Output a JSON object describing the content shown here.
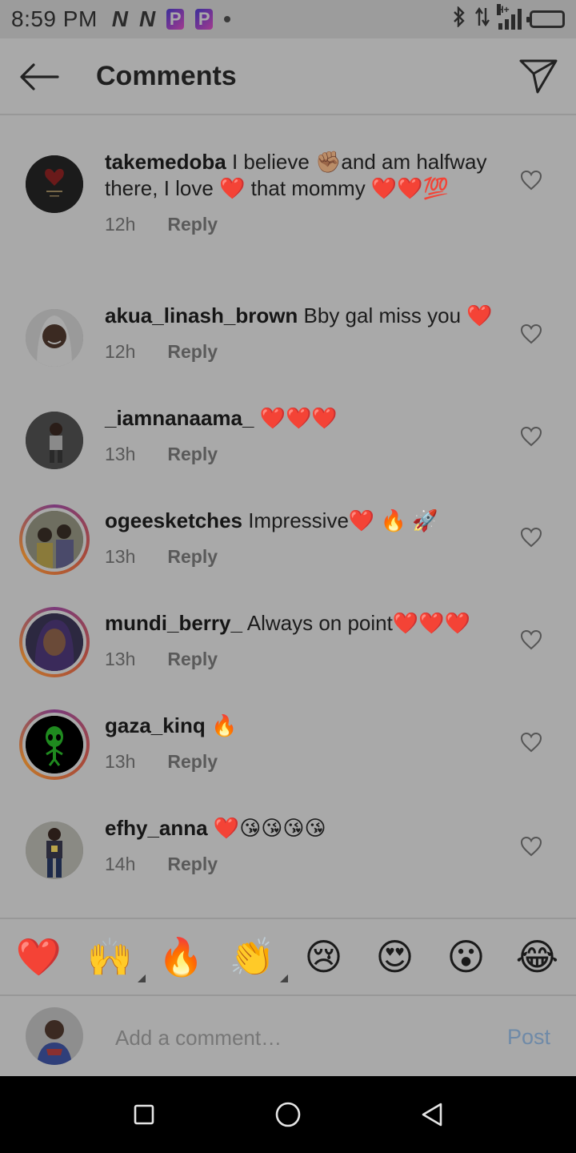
{
  "status_bar": {
    "time": "8:59 PM",
    "notif_icons": [
      "N",
      "N",
      "P",
      "P"
    ],
    "network_label": "H+"
  },
  "header": {
    "title": "Comments"
  },
  "comments": [
    {
      "username": "takemedoba",
      "text": " I believe ✊🏽and am halfway there, I love ❤️ that mommy ❤️❤️💯",
      "time": "12h",
      "reply_label": "Reply"
    },
    {
      "username": "akua_linash_brown",
      "text": " Bby gal miss you ❤️",
      "time": "12h",
      "reply_label": "Reply"
    },
    {
      "username": "_iamnanaama_",
      "text": " ❤️❤️❤️",
      "time": "13h",
      "reply_label": "Reply"
    },
    {
      "username": "ogeesketches",
      "text": " Impressive❤️ 🔥 🚀",
      "time": "13h",
      "reply_label": "Reply"
    },
    {
      "username": "mundi_berry_",
      "text": " Always on point❤️❤️❤️",
      "time": "13h",
      "reply_label": "Reply"
    },
    {
      "username": "gaza_kinq",
      "text": " 🔥",
      "time": "13h",
      "reply_label": "Reply"
    },
    {
      "username": "efhy_anna",
      "text": " ❤️😘😘😘😘",
      "time": "14h",
      "reply_label": "Reply"
    }
  ],
  "emoji_bar": [
    "❤️",
    "🙌",
    "🔥",
    "👏",
    "😢",
    "😍",
    "😮",
    "😂"
  ],
  "composer": {
    "placeholder": "Add a comment…",
    "post_label": "Post"
  },
  "colors": {
    "overlay_bg": "#a9a9a9",
    "post_link": "#6f8aa8",
    "heart": "#8e1717"
  }
}
